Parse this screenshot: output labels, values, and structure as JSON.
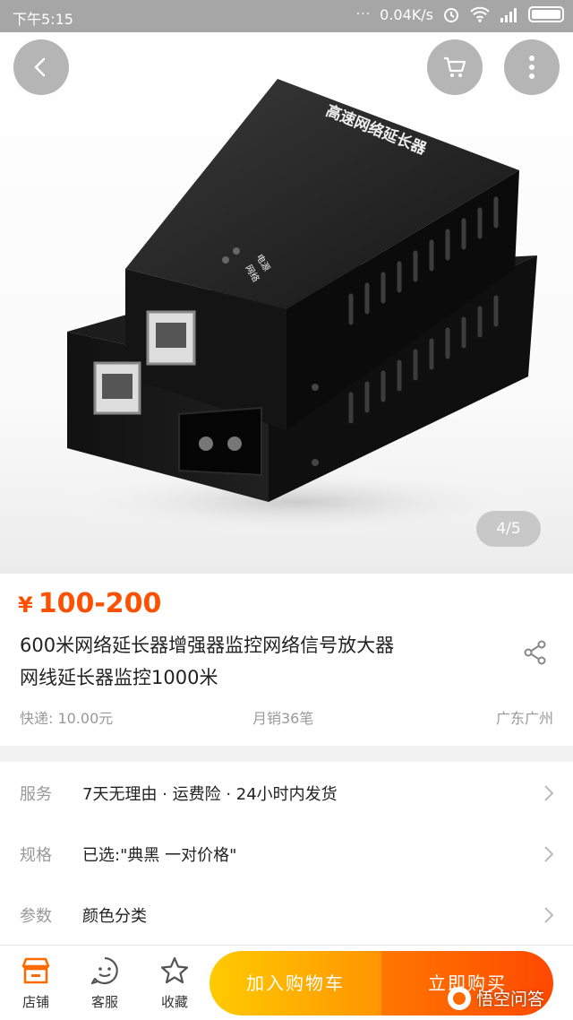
{
  "status_bar": {
    "time": "下午5:15",
    "dots": "···",
    "network_speed": "0.04K/s"
  },
  "gallery": {
    "pager": "4/5",
    "device_label_top": "高速网络延长器",
    "led_label_1": "电源",
    "led_label_2": "网络"
  },
  "product": {
    "currency": "¥",
    "price": "100-200",
    "title_line1": "600米网络延长器增强器监控网络信号放大器",
    "title_line2": "网线延长器监控1000米",
    "shipping": "快递: 10.00元",
    "monthly_sales": "月销36笔",
    "location": "广东广州"
  },
  "rows": [
    {
      "label": "服务",
      "value": "7天无理由 · 运费险 · 24小时内发货"
    },
    {
      "label": "规格",
      "value": "已选:\"典黑 一对价格\""
    },
    {
      "label": "参数",
      "value": "颜色分类"
    }
  ],
  "bottom_bar": {
    "shop_label": "店铺",
    "service_label": "客服",
    "favorite_label": "收藏",
    "add_to_cart": "加入购物车",
    "buy_now": "立即购买"
  },
  "watermark": "悟空问答",
  "colors": {
    "price": "#ff5000",
    "cart_button": "#ffb300",
    "buy_button": "#ff5a00",
    "shop_icon": "#ff6a00"
  }
}
